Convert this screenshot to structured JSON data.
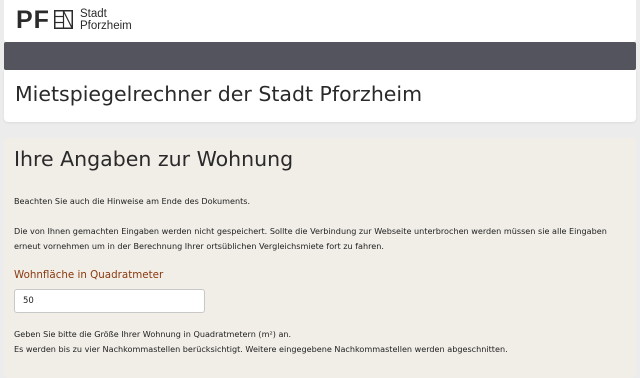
{
  "header": {
    "logo_pf": "PF",
    "logo_city_line1": "Stadt",
    "logo_city_line2": "Pforzheim"
  },
  "page_title": "Mietspiegelrechner der Stadt Pforzheim",
  "form": {
    "heading": "Ihre Angaben zur Wohnung",
    "note": "Beachten Sie auch die Hinweise am Ende des Dokuments.",
    "storage_notice": "Die von Ihnen gemachten Eingaben werden nicht gespeichert. Sollte die Verbindung zur Webseite unterbrochen werden müssen sie alle Eingaben erneut vornehmen um in der Berechnung Ihrer ortsüblichen Vergleichsmiete fort zu fahren.",
    "area_label": "Wohnfläche in Quadratmeter",
    "area_value": "50",
    "area_help_line1": "Geben Sie bitte die Größe Ihrer Wohnung in Quadratmetern (m²) an.",
    "area_help_line2": "Es werden bis zu vier Nachkommastellen berücksichtigt. Weitere eingegebene Nachkommastellen werden abgeschnitten."
  },
  "colors": {
    "header_bar": "#54545e",
    "form_background": "#f1eee8",
    "label_accent": "#8b3a10"
  }
}
